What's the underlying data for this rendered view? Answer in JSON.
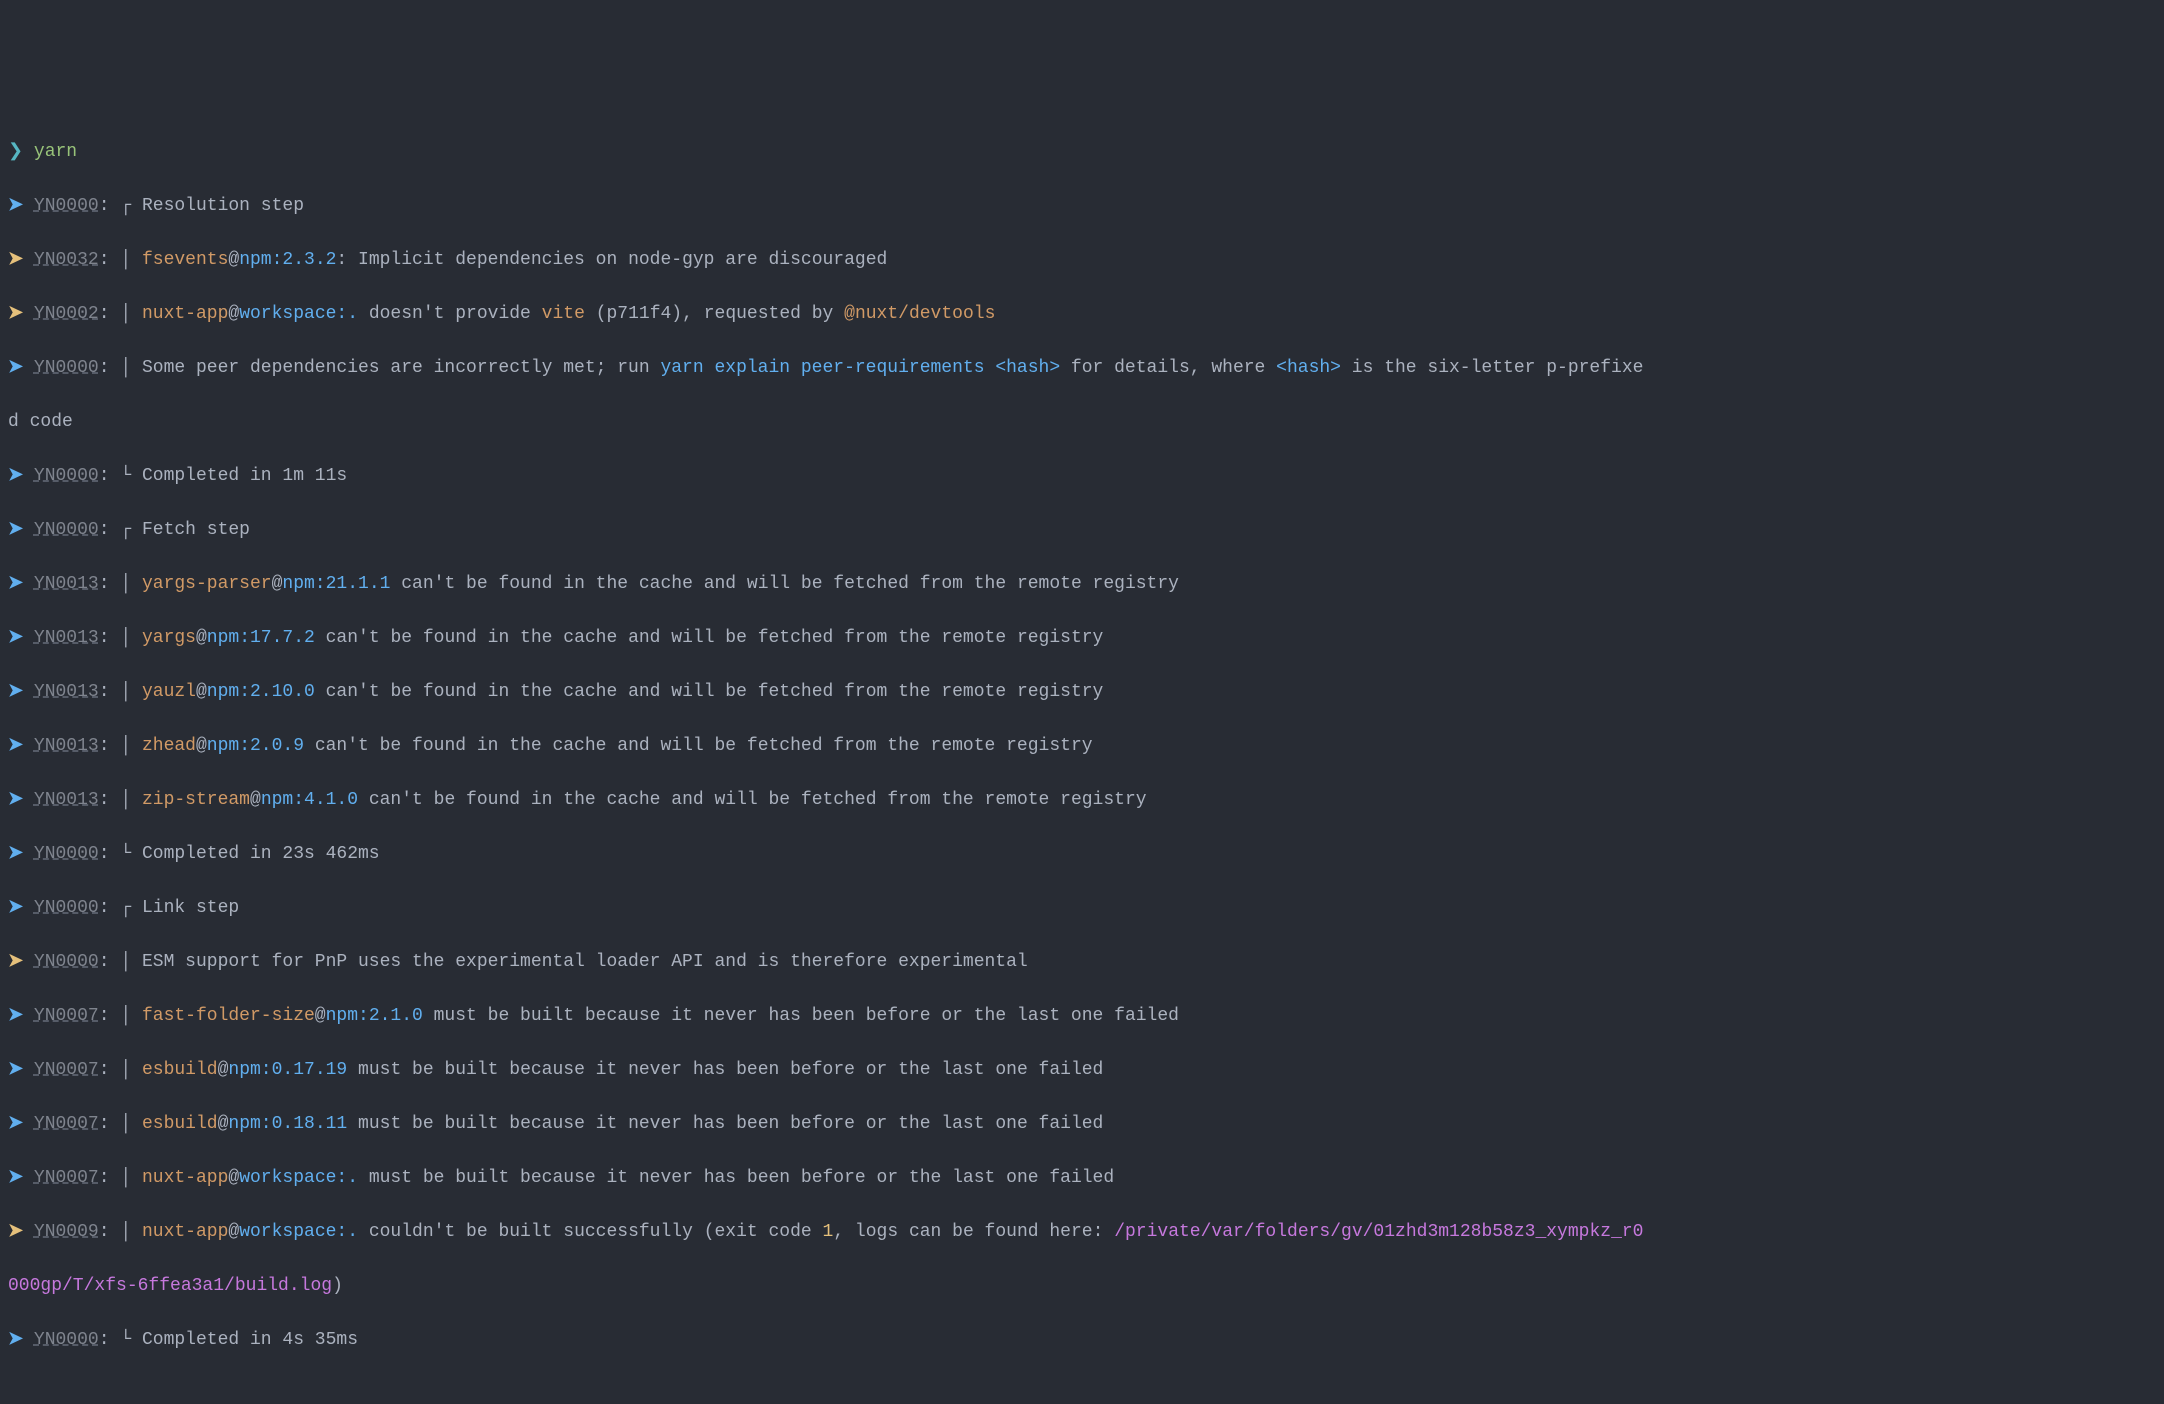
{
  "prompt": {
    "marker": "❯",
    "command": "yarn"
  },
  "codes": {
    "YN0000": "YN0000",
    "YN0032": "YN0032",
    "YN0002": "YN0002",
    "YN0013": "YN0013",
    "YN0007": "YN0007",
    "YN0009": "YN0009"
  },
  "steps": {
    "resolution": "Resolution step",
    "fetch": "Fetch step",
    "link": "Link step"
  },
  "lines": {
    "l1_pkg": "fsevents",
    "l1_scope": "npm:2.3.2",
    "l1_msg": ": Implicit dependencies on node-gyp are discouraged",
    "l2_pkg": "nuxt-app",
    "l2_scope": "workspace:.",
    "l2_mid1": " doesn't provide ",
    "l2_vite": "vite",
    "l2_mid2": " (p711f4), requested by ",
    "l2_req": "@nuxt/devtools",
    "l3_a": "Some peer dependencies are incorrectly met; run ",
    "l3_cmd": "yarn explain peer-requirements ",
    "l3_hash1": "<hash>",
    "l3_b": " for details, where ",
    "l3_hash2": "<hash>",
    "l3_c": " is the six-letter p-prefixe",
    "l3_wrap": "d code",
    "comp1": "Completed in 1m 11s",
    "fetch1_pkg": "yargs-parser",
    "fetch1_scope": "npm:21.1.1",
    "fetch_msg": " can't be found in the cache and will be fetched from the remote registry",
    "fetch2_pkg": "yargs",
    "fetch2_scope": "npm:17.7.2",
    "fetch3_pkg": "yauzl",
    "fetch3_scope": "npm:2.10.0",
    "fetch4_pkg": "zhead",
    "fetch4_scope": "npm:2.0.9",
    "fetch5_pkg": "zip-stream",
    "fetch5_scope": "npm:4.1.0",
    "comp2": "Completed in 23s 462ms",
    "esm_msg": "ESM support for PnP uses the experimental loader API and is therefore experimental",
    "build1_pkg": "fast-folder-size",
    "build1_scope": "npm:2.1.0",
    "build_msg": " must be built because it never has been before or the last one failed",
    "build2_pkg": "esbuild",
    "build2_scope": "npm:0.17.19",
    "build3_pkg": "esbuild",
    "build3_scope": "npm:0.18.11",
    "build4_pkg": "nuxt-app",
    "build4_scope": "workspace:.",
    "fail_pkg": "nuxt-app",
    "fail_scope": "workspace:.",
    "fail_a": " couldn't be built successfully (exit code ",
    "fail_code": "1",
    "fail_b": ", logs can be found here: ",
    "fail_path1": "/private/var/folders/gv/01zhd3m128b58z3_xympkz_r0",
    "fail_path2": "000gp/T/xfs-6ffea3a1/build.log",
    "fail_c": ")",
    "comp3": "Completed in 4s 35ms"
  },
  "glyphs": {
    "arrow": "➤",
    "topcorner": "┌",
    "botcorner": "└",
    "pipe": "│",
    "sep": ":"
  }
}
